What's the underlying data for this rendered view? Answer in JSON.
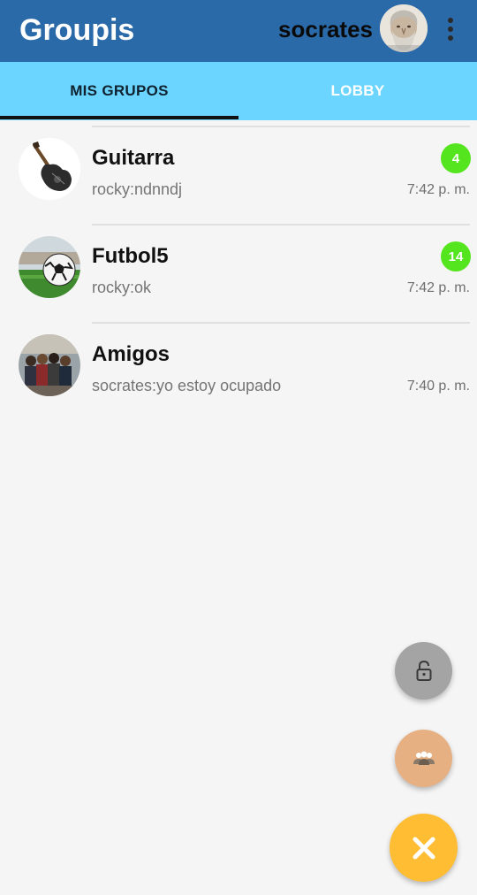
{
  "app": {
    "title": "Groupis",
    "username": "socrates"
  },
  "tabs": [
    {
      "label": "MIS GRUPOS",
      "active": true
    },
    {
      "label": "LOBBY",
      "active": false
    }
  ],
  "groups": [
    {
      "name": "Guitarra",
      "last_message": "rocky:ndnndj",
      "time": "7:42 p. m.",
      "unread": "4",
      "avatar_icon": "guitar-avatar"
    },
    {
      "name": "Futbol5",
      "last_message": "rocky:ok",
      "time": "7:42 p. m.",
      "unread": "14",
      "avatar_icon": "soccer-ball-avatar"
    },
    {
      "name": "Amigos",
      "last_message": "socrates:yo estoy ocupado",
      "time": "7:40 p. m.",
      "unread": null,
      "avatar_icon": "friends-group-avatar"
    }
  ],
  "fabs": [
    {
      "icon": "lock-icon",
      "color": "#a4a4a4"
    },
    {
      "icon": "group-icon",
      "color": "#e6b083"
    },
    {
      "icon": "close-icon",
      "color": "#ffbd34"
    }
  ],
  "colors": {
    "appbar": "#2b6aa8",
    "tabbar": "#6cd5ff",
    "badge": "#55e51e",
    "background": "#f5f5f5"
  }
}
